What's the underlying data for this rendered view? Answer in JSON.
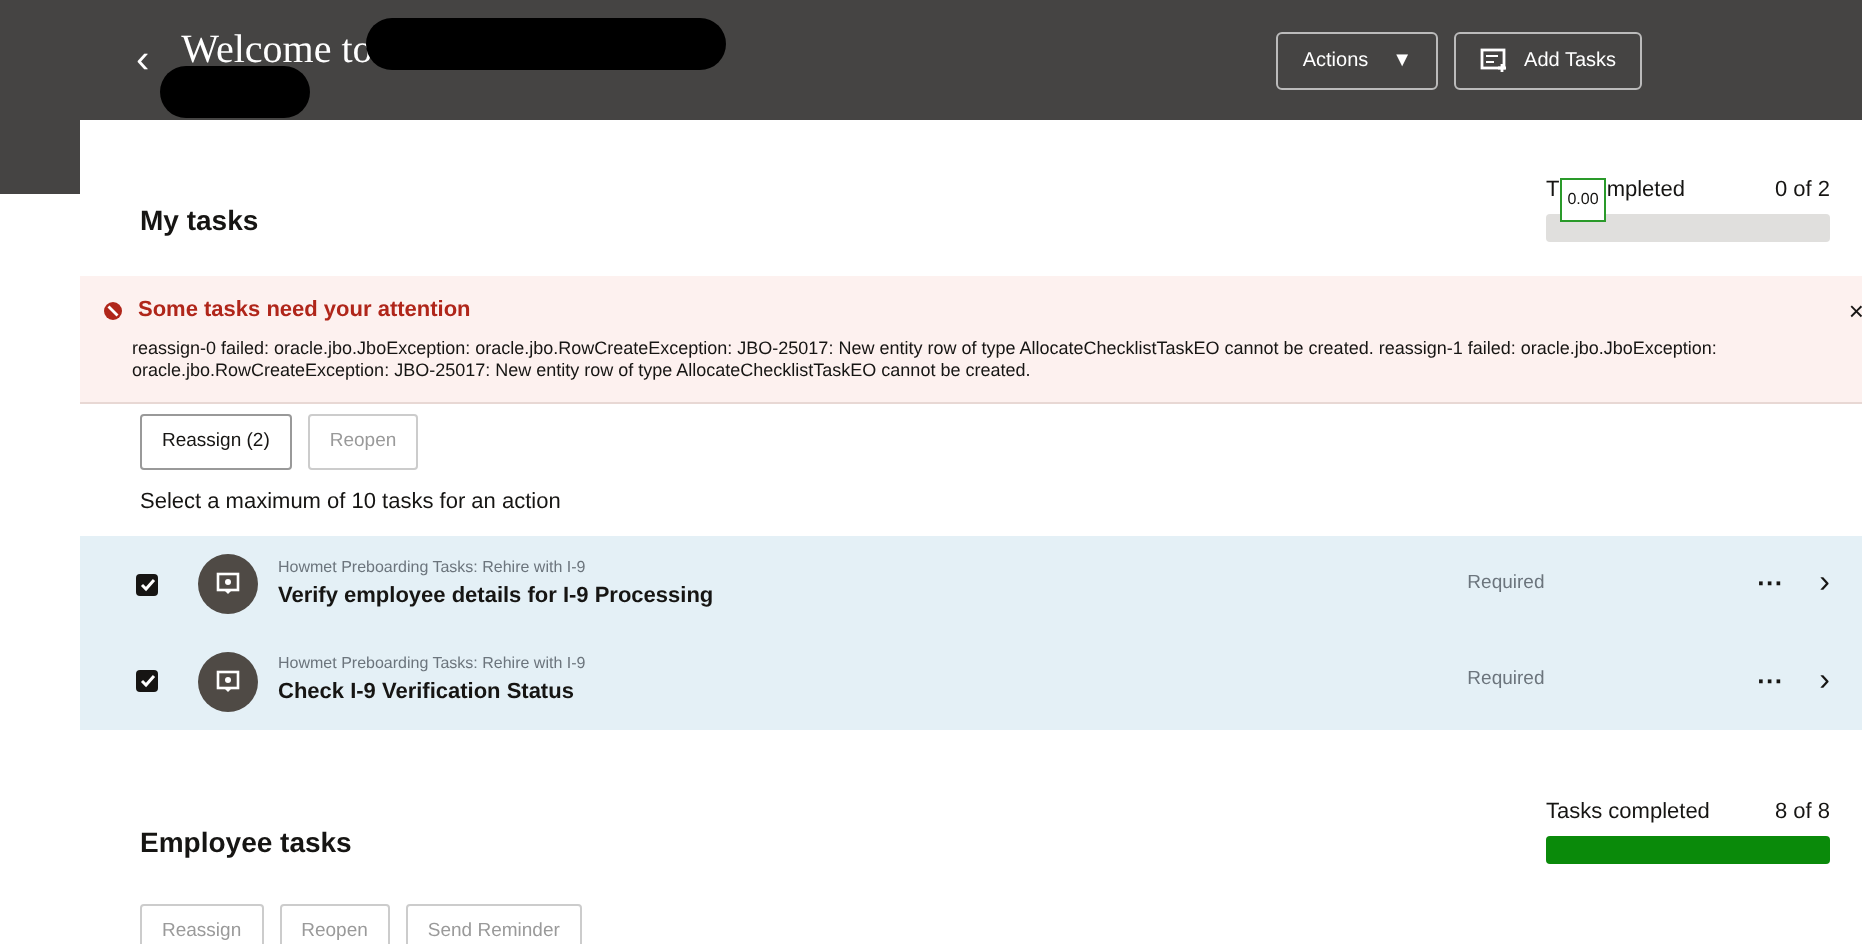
{
  "header": {
    "back": "‹",
    "title": "Welcome to",
    "actions": [
      {
        "label": "Actions",
        "kind": "dropdown",
        "caret": "▼"
      },
      {
        "label": "Add Tasks",
        "kind": "add"
      }
    ]
  },
  "my_tasks": {
    "title": "My tasks",
    "progress": {
      "label_start": "T",
      "tooltip": "0.00",
      "label_end": "mpleted",
      "count": "0 of 2",
      "level": 0
    },
    "alert": {
      "title": "Some tasks need your attention",
      "message": "reassign-0 failed: oracle.jbo.JboException: oracle.jbo.RowCreateException: JBO-25017: New entity row of type AllocateChecklistTaskEO cannot be created. reassign-1 failed: oracle.jbo.JboException: oracle.jbo.RowCreateException: JBO-25017: New entity row of type AllocateChecklistTaskEO cannot be created.",
      "close": "×"
    },
    "buttons": [
      {
        "label": "Reassign (2)",
        "disabled": false
      },
      {
        "label": "Reopen",
        "disabled": true
      }
    ],
    "hint": "Select a maximum of 10 tasks for an action",
    "tasks": [
      {
        "category": "Howmet Preboarding Tasks: Rehire with I-9",
        "title": "Verify employee details for I-9 Processing",
        "status": "Required",
        "checked": true,
        "more": "···",
        "chevron": "›"
      },
      {
        "category": "Howmet Preboarding Tasks: Rehire with I-9",
        "title": "Check I-9 Verification Status",
        "status": "Required",
        "checked": true,
        "more": "···",
        "chevron": "›"
      }
    ]
  },
  "employee_tasks": {
    "title": "Employee tasks",
    "progress": {
      "label": "Tasks completed",
      "count": "8 of 8",
      "level": 1
    },
    "buttons": [
      {
        "label": "Reassign",
        "disabled": true
      },
      {
        "label": "Reopen",
        "disabled": true
      },
      {
        "label": "Send Reminder",
        "disabled": true
      }
    ]
  }
}
